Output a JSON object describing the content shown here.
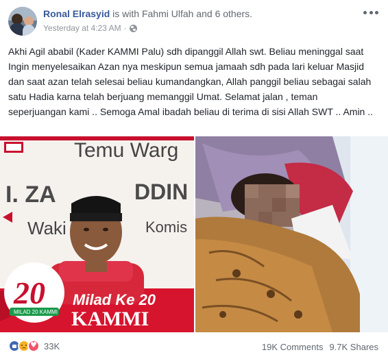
{
  "post": {
    "author": "Ronal Elrasyid",
    "with_text": " is with ",
    "tagged_name": "Fahmi Ulfah",
    "and_text": " and ",
    "others_text": "6 others",
    "period": ".",
    "timestamp": "Yesterday at 4:23 AM",
    "separator": "·",
    "body": "Akhi Agil ababil (Kader KAMMI Palu) sdh dipanggil Allah swt. Beliau meninggal saat Ingin menyelesaikan Azan nya meskipun semua jamaah sdh pada lari keluar Masjid dan saat azan telah selesai beliau kumandangkan, Allah panggil beliau sebagai salah satu Hadia karna telah berjuang memanggil Umat. Selamat jalan , teman seperjuangan kami .. Semoga Amal ibadah beliau di terima di sisi Allah SWT .. Amin .."
  },
  "poster": {
    "title_top": "Temu Warg",
    "name_fragment": "I. ZA",
    "name_fragment2": "DDIN",
    "role_fragment": "Waki",
    "role_fragment2": "Komis",
    "milad_line": "Milad Ke 20",
    "kammi": "KAMMI",
    "badge_sub": "MILAD 20 KAMMI",
    "logo_text": "20"
  },
  "reactions": {
    "icons": [
      "like-icon",
      "sad-icon",
      "love-icon"
    ],
    "count": "33K"
  },
  "stats": {
    "comments": "19K Comments",
    "shares": "9.7K Shares"
  },
  "colors": {
    "link": "#365899",
    "meta": "#90949c",
    "like": "#4267b2",
    "love": "#f25268",
    "sad": "#f7b125",
    "kammi_red": "#c8102e"
  }
}
